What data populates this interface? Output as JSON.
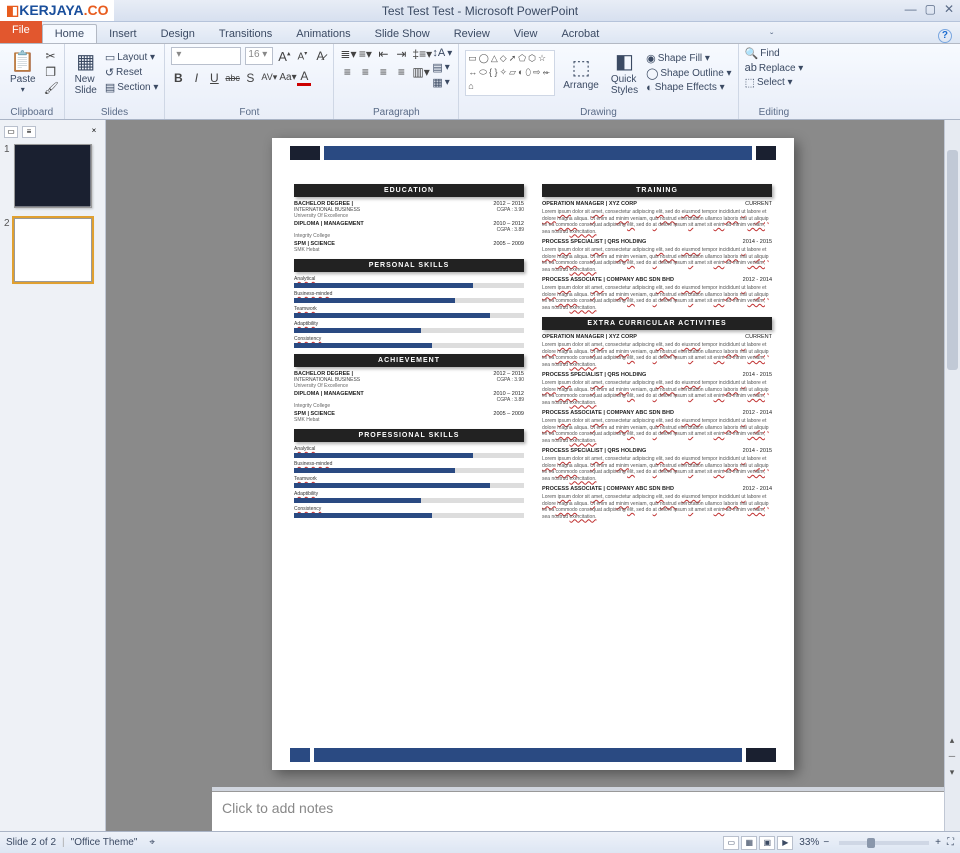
{
  "logo": {
    "k": "KERJAYA",
    "co": ".CO"
  },
  "title": "Test Test Test - Microsoft PowerPoint",
  "win": {
    "min": "—",
    "max": "▢",
    "close": "✕"
  },
  "tabs": {
    "file": "File",
    "home": "Home",
    "insert": "Insert",
    "design": "Design",
    "transitions": "Transitions",
    "animations": "Animations",
    "slideshow": "Slide Show",
    "review": "Review",
    "view": "View",
    "acrobat": "Acrobat"
  },
  "ribbon": {
    "clipboard": {
      "title": "Clipboard",
      "paste": "Paste",
      "cut": "Cut",
      "copy": "Copy",
      "fmt": "Format Painter"
    },
    "slides": {
      "title": "Slides",
      "new": "New\nSlide",
      "layout": "Layout ▾",
      "reset": "Reset",
      "section": "Section ▾"
    },
    "font": {
      "title": "Font",
      "size": "16",
      "grow": "A",
      "shrink": "A",
      "clear": "Aª",
      "bold": "B",
      "italic": "I",
      "underline": "U",
      "strike": "abc",
      "shadow": "S",
      "spacing": "AV",
      "case": "Aa",
      "color": "A"
    },
    "paragraph": {
      "title": "Paragraph",
      "bul": "•",
      "num": "1.",
      "lvl": "≡",
      "dir": "¶",
      "align_l": "≡",
      "align_c": "≡",
      "align_r": "≡",
      "align_j": "≡",
      "cols": "▭",
      "textdir": "Text Direction",
      "alignv": "Align Text",
      "smartart": "Convert to SmartArt"
    },
    "drawing": {
      "title": "Drawing",
      "arrange": "Arrange",
      "quick": "Quick\nStyles",
      "fill": "Shape Fill ▾",
      "outline": "Shape Outline ▾",
      "effects": "Shape Effects ▾"
    },
    "editing": {
      "title": "Editing",
      "find": "Find",
      "replace": "Replace ▾",
      "select": "Select ▾"
    }
  },
  "thumbs": {
    "n1": "1",
    "n2": "2"
  },
  "slide": {
    "sections": {
      "edu": "EDUCATION",
      "train": "TRAINING",
      "pskills": "PERSONAL SKILLS",
      "ach": "ACHIEVEMENT",
      "extra": "EXTRA CURRICULAR ACTIVITIES",
      "prof": "PROFESSIONAL SKILLS"
    },
    "edu": [
      {
        "deg": "BACHELOR DEGREE |",
        "field": "INTERNATIONAL BUSINESS",
        "school": "University Of Excellence",
        "yr": "2012 – 2015",
        "gpa": "CGPA : 3.90"
      },
      {
        "deg": "DIPLOMA | MANAGEMENT",
        "field": "",
        "school": "Integrity College",
        "yr": "2010 – 2012",
        "gpa": "CGPA : 3.89"
      },
      {
        "deg": "SPM | SCIENCE",
        "field": "",
        "school": "SMK Hebat",
        "yr": "2005 – 2009",
        "gpa": ""
      }
    ],
    "skills": [
      {
        "n": "Analytical",
        "v": 78
      },
      {
        "n": "Business-minded",
        "v": 70
      },
      {
        "n": "Teamwork",
        "v": 85
      },
      {
        "n": "Adaptibility",
        "v": 55
      },
      {
        "n": "Consistency",
        "v": 60
      }
    ],
    "jobs": [
      {
        "t": "OPERATION MANAGER | XYZ CORP",
        "d": "CURRENT"
      },
      {
        "t": "PROCESS SPECIALIST | QRS HOLDING",
        "d": "2014 - 2015"
      },
      {
        "t": "PROCESS ASSOCIATE | COMPANY ABC SDN BHD",
        "d": "2012 - 2014"
      }
    ],
    "lorem": "Lorem ipsum dolor sit amet, consectetur adipiscing elit, sed do eiusmod tempor incididunt ut labore et dolore magna aliqua. Ut enim ad minim veniam, quis nostrud exercitation ullamco laboris nisi ut aliquip ex ea commodo consequat adipiscing elit, sed do at dolore ipsum sit amet sit enim ad minim veniam, sea nostrud exercitation."
  },
  "notes": "Click to add notes",
  "status": {
    "slide": "Slide 2 of 2",
    "theme": "\"Office Theme\"",
    "lang": "⌖",
    "zoom": "33%",
    "minus": "−",
    "plus": "+",
    "fit": "⛶"
  }
}
